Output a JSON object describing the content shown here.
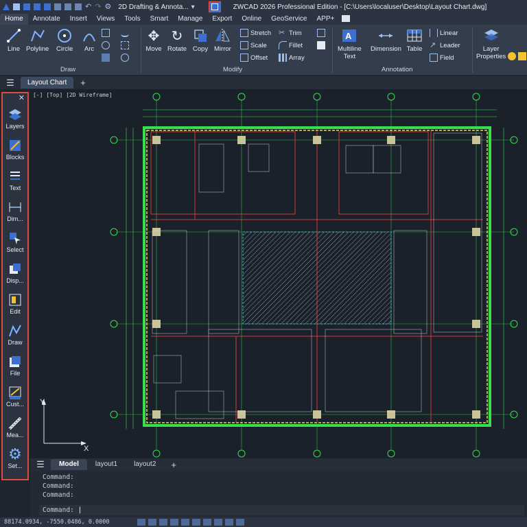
{
  "titlebar": {
    "workspace": "2D Drafting & Annota...",
    "title": "ZWCAD 2026 Professional Edition - [C:\\Users\\localuser\\Desktop\\Layout Chart.dwg]"
  },
  "menu": [
    "Home",
    "Annotate",
    "Insert",
    "Views",
    "Tools",
    "Smart",
    "Manage",
    "Export",
    "Online",
    "GeoService",
    "APP+"
  ],
  "ribbon": {
    "draw": {
      "group": "Draw",
      "line": "Line",
      "polyline": "Polyline",
      "circle": "Circle",
      "arc": "Arc"
    },
    "modify": {
      "group": "Modify",
      "move": "Move",
      "rotate": "Rotate",
      "copy": "Copy",
      "mirror": "Mirror",
      "stretch": "Stretch",
      "scale": "Scale",
      "offset": "Offset",
      "trim": "Trim",
      "fillet": "Fillet",
      "array": "Array"
    },
    "annotation": {
      "group": "Annotation",
      "multiline_text": "Multiline",
      "multiline_text2": "Text",
      "dimension": "Dimension",
      "table": "Table",
      "linear": "Linear",
      "leader": "Leader",
      "field": "Field"
    },
    "layers": {
      "layer_properties": "Layer",
      "layer_properties2": "Properties"
    }
  },
  "doc_tab": "Layout Chart",
  "viewport_label": "[-] [Top] [2D Wireframe]",
  "left_panel": [
    "Layers",
    "Blocks",
    "Text",
    "Dim...",
    "Select",
    "Disp...",
    "Edit",
    "Draw",
    "File",
    "Cust...",
    "Mea...",
    "Set..."
  ],
  "ucs": {
    "x": "X",
    "y": "Y"
  },
  "layout_tabs": [
    "Model",
    "layout1",
    "layout2"
  ],
  "command_history": [
    "Command:",
    "Command:",
    "Command:"
  ],
  "command_prompt": "Command:",
  "status_coords": "88174.0934, -7550.0486, 0.0000",
  "colors": {
    "accent": "#3c6fd0",
    "highlight": "#e04b3a",
    "plan_green": "#35e04a",
    "plan_red": "#d23a3a",
    "plan_yellow": "#e8e23a"
  }
}
